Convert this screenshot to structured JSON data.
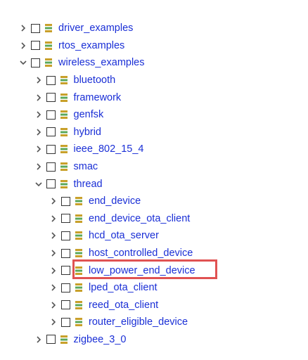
{
  "tree": {
    "items": [
      {
        "label": "driver_examples",
        "level": 0,
        "expanded": false
      },
      {
        "label": "rtos_examples",
        "level": 0,
        "expanded": false
      },
      {
        "label": "wireless_examples",
        "level": 0,
        "expanded": true
      },
      {
        "label": "bluetooth",
        "level": 1,
        "expanded": false
      },
      {
        "label": "framework",
        "level": 1,
        "expanded": false
      },
      {
        "label": "genfsk",
        "level": 1,
        "expanded": false
      },
      {
        "label": "hybrid",
        "level": 1,
        "expanded": false
      },
      {
        "label": "ieee_802_15_4",
        "level": 1,
        "expanded": false
      },
      {
        "label": "smac",
        "level": 1,
        "expanded": false
      },
      {
        "label": "thread",
        "level": 1,
        "expanded": true
      },
      {
        "label": "end_device",
        "level": 2,
        "expanded": false
      },
      {
        "label": "end_device_ota_client",
        "level": 2,
        "expanded": false
      },
      {
        "label": "hcd_ota_server",
        "level": 2,
        "expanded": false
      },
      {
        "label": "host_controlled_device",
        "level": 2,
        "expanded": false
      },
      {
        "label": "low_power_end_device",
        "level": 2,
        "expanded": false,
        "highlighted": true
      },
      {
        "label": "lped_ota_client",
        "level": 2,
        "expanded": false
      },
      {
        "label": "reed_ota_client",
        "level": 2,
        "expanded": false
      },
      {
        "label": "router_eligible_device",
        "level": 2,
        "expanded": false
      },
      {
        "label": "zigbee_3_0",
        "level": 1,
        "expanded": false
      }
    ]
  },
  "colors": {
    "label": "#1a2fd6",
    "twisty": "#555555",
    "highlight_border": "#e05252",
    "icon_gold": "#c8a02a",
    "icon_green": "#5ba85b"
  },
  "icons": {
    "collapsed": "chevron-right-icon",
    "expanded": "chevron-down-icon",
    "item": "package-icon"
  }
}
